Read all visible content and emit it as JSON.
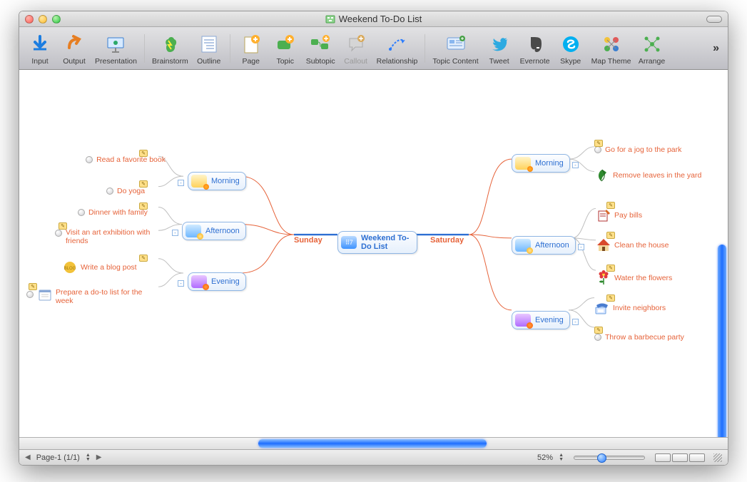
{
  "window": {
    "title": "Weekend To-Do List",
    "doc_icon": "mindmap-doc-icon"
  },
  "toolbar": [
    {
      "id": "input",
      "label": "Input",
      "icon": "input-icon",
      "enabled": true
    },
    {
      "id": "output",
      "label": "Output",
      "icon": "output-icon",
      "enabled": true
    },
    {
      "id": "presentation",
      "label": "Presentation",
      "icon": "presentation-icon",
      "enabled": true
    },
    {
      "sep": true
    },
    {
      "id": "brainstorm",
      "label": "Brainstorm",
      "icon": "brainstorm-icon",
      "enabled": true
    },
    {
      "id": "outline",
      "label": "Outline",
      "icon": "outline-icon",
      "enabled": true
    },
    {
      "sep": true
    },
    {
      "id": "page",
      "label": "Page",
      "icon": "page-icon",
      "enabled": true
    },
    {
      "id": "topic",
      "label": "Topic",
      "icon": "topic-icon",
      "enabled": true
    },
    {
      "id": "subtopic",
      "label": "Subtopic",
      "icon": "subtopic-icon",
      "enabled": true
    },
    {
      "id": "callout",
      "label": "Callout",
      "icon": "callout-icon",
      "enabled": false
    },
    {
      "id": "relationship",
      "label": "Relationship",
      "icon": "relationship-icon",
      "enabled": true
    },
    {
      "sep": true
    },
    {
      "id": "topic-content",
      "label": "Topic Content",
      "icon": "topic-content-icon",
      "enabled": true
    },
    {
      "id": "tweet",
      "label": "Tweet",
      "icon": "twitter-icon",
      "enabled": true
    },
    {
      "id": "evernote",
      "label": "Evernote",
      "icon": "evernote-icon",
      "enabled": true
    },
    {
      "id": "skype",
      "label": "Skype",
      "icon": "skype-icon",
      "enabled": true
    },
    {
      "id": "map-theme",
      "label": "Map Theme",
      "icon": "map-theme-icon",
      "enabled": true
    },
    {
      "id": "arrange",
      "label": "Arrange",
      "icon": "arrange-icon",
      "enabled": true
    }
  ],
  "mindmap": {
    "root": "Weekend To-Do List",
    "right": {
      "day": "Saturday",
      "sections": [
        {
          "label": "Morning",
          "items": [
            {
              "text": "Go for a jog to the park",
              "icon": null
            },
            {
              "text": "Remove leaves in the yard",
              "icon": "leaf"
            }
          ]
        },
        {
          "label": "Afternoon",
          "items": [
            {
              "text": "Pay bills",
              "icon": "notepad"
            },
            {
              "text": "Clean the house",
              "icon": "house"
            },
            {
              "text": "Water the flowers",
              "icon": "flower"
            }
          ]
        },
        {
          "label": "Evening",
          "items": [
            {
              "text": "Invite neighbors",
              "icon": "phone"
            },
            {
              "text": "Throw a barbecue party",
              "icon": null
            }
          ]
        }
      ]
    },
    "left": {
      "day": "Sunday",
      "sections": [
        {
          "label": "Morning",
          "items": [
            {
              "text": "Read a favorite book",
              "icon": null
            },
            {
              "text": "Do yoga",
              "icon": null
            }
          ]
        },
        {
          "label": "Afternoon",
          "items": [
            {
              "text": "Dinner with family",
              "icon": null
            },
            {
              "text": "Visit an art exhibition with friends",
              "icon": null
            }
          ]
        },
        {
          "label": "Evening",
          "items": [
            {
              "text": "Write a blog post",
              "icon": "stamp"
            },
            {
              "text": "Prepare a do-to list for the week",
              "icon": "calendar"
            }
          ]
        }
      ]
    }
  },
  "status": {
    "page_label": "Page-1 (1/1)",
    "zoom_pct": "52%"
  }
}
